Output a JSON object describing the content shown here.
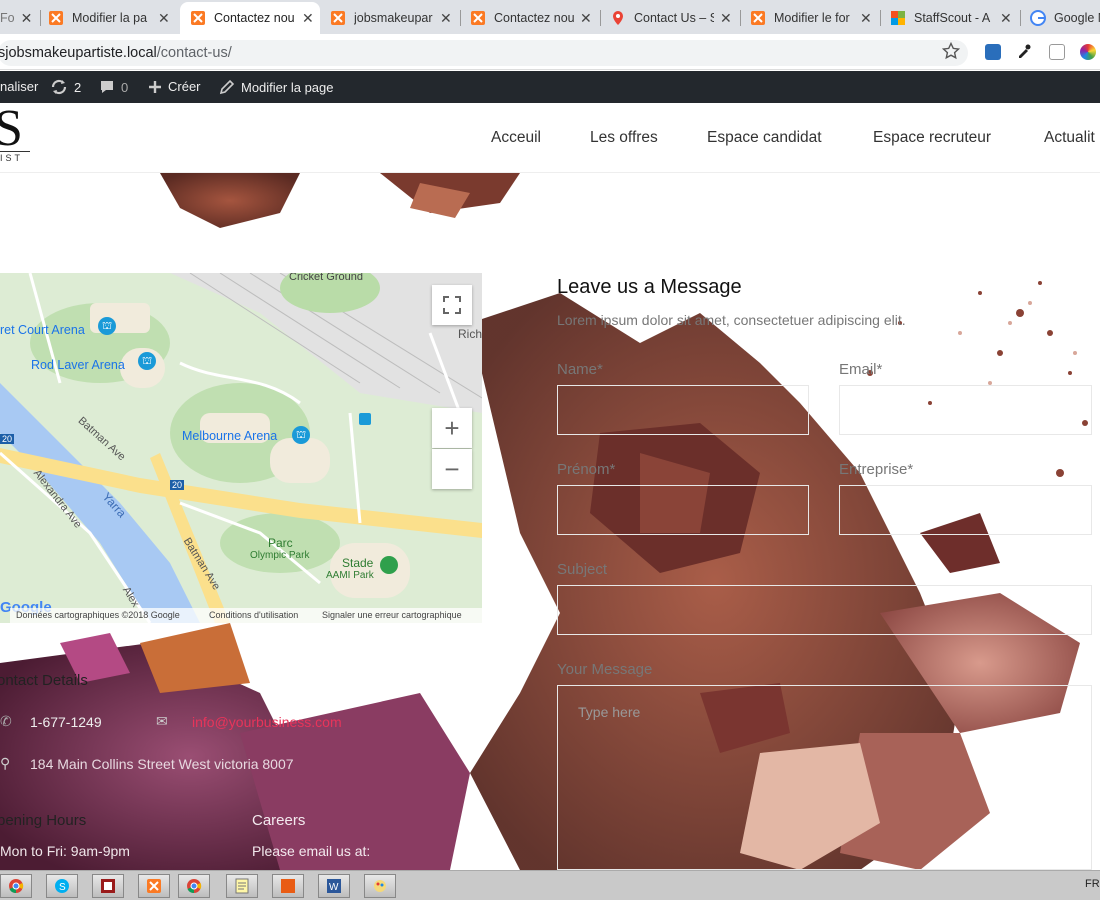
{
  "browser": {
    "tabs": [
      {
        "label": "Fo",
        "icon": "xampp-icon"
      },
      {
        "label": "Modifier la pa",
        "icon": "xampp-icon"
      },
      {
        "label": "Contactez nou",
        "icon": "xampp-icon",
        "active": true
      },
      {
        "label": "jobsmakeupar",
        "icon": "xampp-icon"
      },
      {
        "label": "Contactez nou",
        "icon": "xampp-icon"
      },
      {
        "label": "Contact Us – S",
        "icon": "map-pin-icon"
      },
      {
        "label": "Modifier le for",
        "icon": "xampp-icon"
      },
      {
        "label": "StaffScout - A",
        "icon": "staffscout-icon"
      },
      {
        "label": "Google M",
        "icon": "google-icon"
      }
    ],
    "close_glyph": "✕",
    "url_host": "jobsmakeupartiste.local",
    "url_path": "/contact-us/",
    "url_prefix": "s"
  },
  "wp_admin_bar": {
    "customize": "naliser",
    "updates_count": "2",
    "comments_count": "0",
    "create": "Créer",
    "edit_page": "Modifier la page"
  },
  "site": {
    "logo_letter": "S",
    "logo_sub": "IST",
    "nav": [
      "Acceuil",
      "Les offres",
      "Espace candidat",
      "Espace recruteur",
      "Actualit"
    ]
  },
  "map": {
    "labels": {
      "cricket": "Cricket Ground",
      "court_arena": "ret Court Arena",
      "rod_laver": "Rod Laver Arena",
      "melbourne_arena": "Melbourne Arena",
      "batman1": "Batman Ave",
      "batman2": "Batman Ave",
      "alexandra": "Alexandra Ave",
      "yarra": "Yarra",
      "route20a": "20",
      "route20b": "20",
      "parc": "Parc",
      "olympic": "Olympic Park",
      "stade": "Stade",
      "aami": "AAMI Park",
      "rich": "Rich",
      "alex2": "Alex"
    },
    "google_logo": "Google",
    "footer": [
      "Données cartographiques ©2018 Google",
      "Conditions d'utilisation",
      "Signaler une erreur cartographique"
    ],
    "zoom_in": "+",
    "zoom_out": "−"
  },
  "form": {
    "title": "Leave us a Message",
    "subtitle": "Lorem ipsum dolor sit amet, consectetuer adipiscing elit.",
    "name_label": "Name*",
    "email_label": "Email*",
    "prenom_label": "Prénom*",
    "entreprise_label": "Entreprise*",
    "subject_label": "Subject",
    "message_label": "Your Message",
    "message_placeholder": "Type here"
  },
  "contact": {
    "heading": "ontact Details",
    "phone": "1-677-1249",
    "email": "info@yourbusiness.com",
    "address": "184 Main Collins Street West victoria 8007",
    "hours_heading": "pening Hours",
    "hours": "Mon to Fri: 9am-9pm",
    "careers_heading": "Careers",
    "careers_text": "Please email us at:"
  },
  "taskbar": {
    "lang": "FR",
    "apps": [
      "chrome-icon",
      "skype-icon",
      "app-red-icon",
      "xampp-icon",
      "chrome-icon",
      "notepad-icon",
      "office-icon",
      "word-icon",
      "paint-icon"
    ]
  },
  "colors": {
    "accent": "#e8345a",
    "wpbar": "#23282d",
    "tabbar": "#dee1e6"
  }
}
